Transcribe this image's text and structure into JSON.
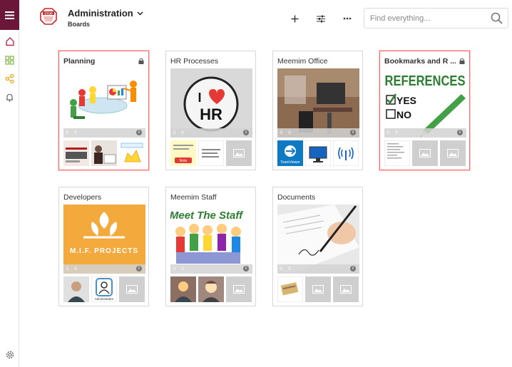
{
  "header": {
    "title": "Administration",
    "subtitle": "Boards",
    "logo_text": "STOP"
  },
  "search": {
    "placeholder": "Find everything..."
  },
  "colors": {
    "accent": "#6b1739",
    "selected_border": "#ff6b6b",
    "placeholder_bg": "#cfcfcf"
  },
  "boards": [
    {
      "title": "Planning",
      "locked": true,
      "selected": true,
      "stats": [
        "0",
        "0"
      ]
    },
    {
      "title": "HR Processes",
      "locked": false,
      "selected": false,
      "stats": [
        "2",
        "0"
      ],
      "hero_text": [
        "I",
        "HR"
      ],
      "thumb_label": "Note"
    },
    {
      "title": "Meemim Office",
      "locked": false,
      "selected": false,
      "stats": [
        "0",
        "0"
      ],
      "thumb_label": "TeamViewer"
    },
    {
      "title": "Bookmarks and R ...",
      "locked": true,
      "selected": true,
      "stats": [
        "0",
        "0"
      ],
      "hero_text": [
        "REFERENCES",
        "YES",
        "NO"
      ]
    },
    {
      "title": "Developers",
      "locked": false,
      "selected": false,
      "stats": [
        "2",
        "0"
      ],
      "hero_text": [
        "M.I.F. PROJECTS"
      ],
      "thumb_label": "Administrator"
    },
    {
      "title": "Meemim Staff",
      "locked": false,
      "selected": false,
      "stats": [
        "0",
        "0"
      ],
      "hero_text": [
        "Meet The Staff"
      ]
    },
    {
      "title": "Documents",
      "locked": false,
      "selected": false,
      "stats": [
        "0",
        "0"
      ]
    }
  ]
}
